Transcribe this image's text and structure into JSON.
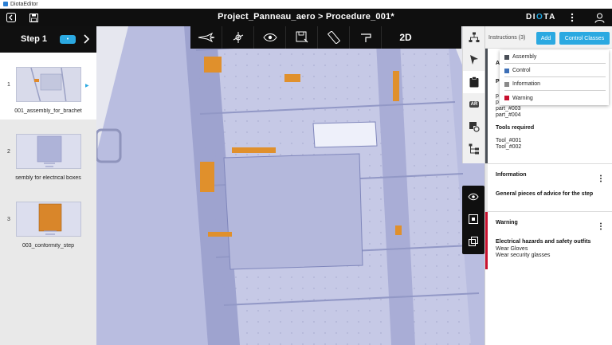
{
  "os_window": {
    "title": "DiotaEditor"
  },
  "header": {
    "title": "Project_Panneau_aero > Procedure_001*",
    "brand_prefix": "DI",
    "brand_accent": "O",
    "brand_suffix": "TA",
    "icons": [
      "back-icon",
      "save-icon",
      "more-icon",
      "user-icon"
    ]
  },
  "step_panel": {
    "label": "Step 1",
    "pill": "•",
    "steps": [
      {
        "num": "1",
        "name": "001_assembly_for_brachet"
      },
      {
        "num": "2",
        "name": "sembly for electrical boxes"
      },
      {
        "num": "3",
        "name": "003_conformity_step"
      }
    ]
  },
  "toolbar": {
    "tools": [
      "plane-icon",
      "axis-icon",
      "eye-icon",
      "save-view-icon",
      "measure-icon",
      "section-icon"
    ],
    "mode_label": "2D"
  },
  "right_strip": {
    "ar_label": "AR"
  },
  "instructions": {
    "title": "Instructions (3)",
    "add_label": "Add",
    "control_classes_label": "Control Classes",
    "assembly": {
      "title_partial": "A",
      "parts_partial": "P",
      "parts_lines_partial": [
        "p",
        "p"
      ],
      "parts": [
        "part_#003",
        "part_#004"
      ],
      "tools_title": "Tools required",
      "tools": [
        "Tool_#001",
        "Tool_#002"
      ]
    },
    "information": {
      "title": "Information",
      "body": "General pieces of advice for the step",
      "color": "#e8e8e8"
    },
    "warning": {
      "title": "Warning",
      "body_title": "Electrical hazards and safety outfits",
      "lines": [
        "Wear Gloves",
        "Wear security glasses"
      ],
      "color": "#c8102e"
    }
  },
  "control_classes_menu": {
    "items": [
      {
        "label": "Assembly",
        "color": "#4a4f57"
      },
      {
        "label": "Control",
        "color": "#3d6fb6"
      },
      {
        "label": "Information",
        "color": "#8a8a8a"
      },
      {
        "label": "Warning",
        "color": "#c8102e"
      }
    ]
  }
}
